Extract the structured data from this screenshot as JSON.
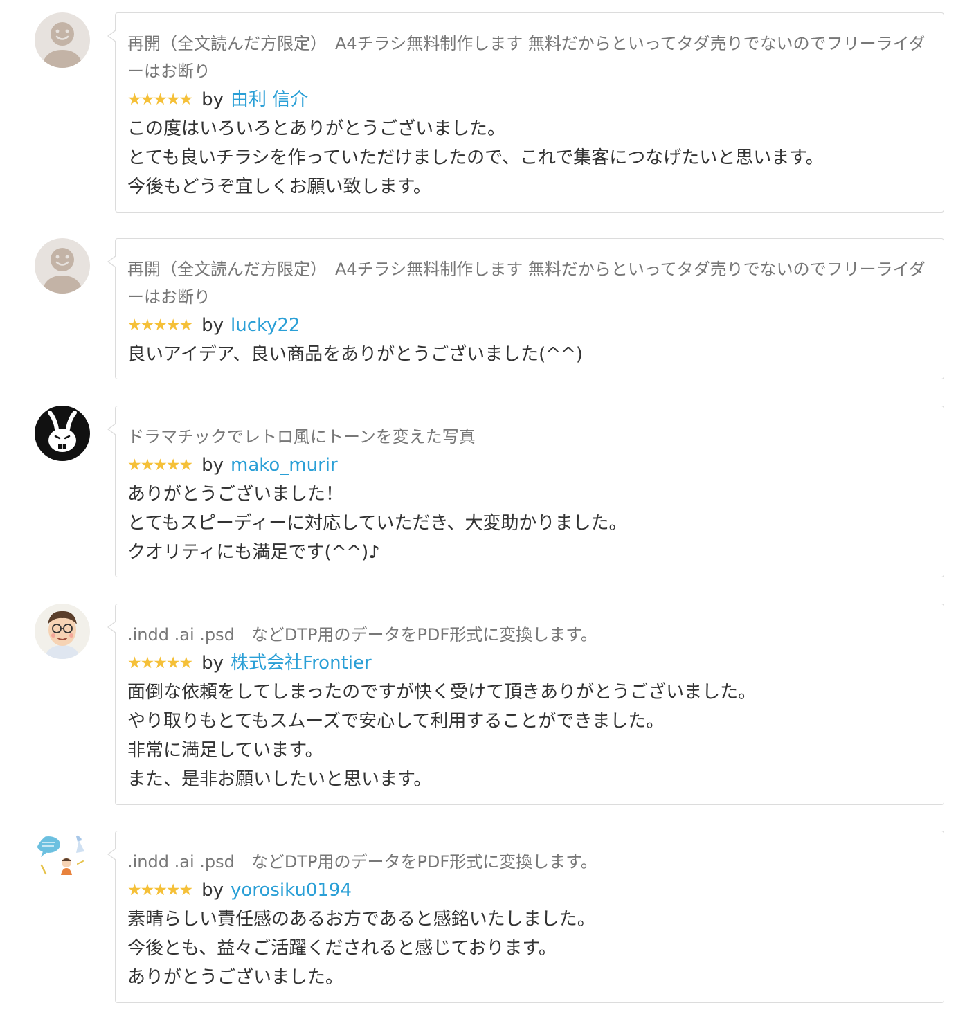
{
  "reviews": [
    {
      "avatar_icon": "default-user-icon",
      "service_title": "再開（全文読んだ方限定）　A4チラシ無料制作します 無料だからといってタダ売りでないのでフリーライダーはお断り",
      "stars": "★★★★★",
      "rating": 5,
      "by": "by",
      "username": "由利 信介",
      "comment": [
        "この度はいろいろとありがとうございました。",
        "とても良いチラシを作っていただけましたので、これで集客につなげたいと思います。",
        "今後もどうぞ宜しくお願い致します。"
      ]
    },
    {
      "avatar_icon": "default-user-icon",
      "service_title": "再開（全文読んだ方限定）　A4チラシ無料制作します 無料だからといってタダ売りでないのでフリーライダーはお断り",
      "stars": "★★★★★",
      "rating": 5,
      "by": "by",
      "username": "lucky22",
      "comment": [
        "良いアイデア、良い商品をありがとうございました(^^)"
      ]
    },
    {
      "avatar_icon": "rabbit-avatar-icon",
      "service_title": "ドラマチックでレトロ風にトーンを変えた写真",
      "stars": "★★★★★",
      "rating": 5,
      "by": "by",
      "username": "mako_murir",
      "comment": [
        "ありがとうございました！",
        "とてもスピーディーに対応していただき、大変助かりました。",
        "クオリティにも満足です(^^)♪"
      ]
    },
    {
      "avatar_icon": "man-glasses-avatar-icon",
      "service_title": ".indd .ai .psd　などDTP用のデータをPDF形式に変換します。",
      "stars": "★★★★★",
      "rating": 5,
      "by": "by",
      "username": "株式会社Frontier",
      "comment": [
        "面倒な依頼をしてしまったのですが快く受けて頂きありがとうございました。",
        "やり取りもとてもスムーズで安心して利用することができました。",
        "非常に満足しています。",
        "また、是非お願いしたいと思います。"
      ]
    },
    {
      "avatar_icon": "illustration-avatar-icon",
      "service_title": ".indd .ai .psd　などDTP用のデータをPDF形式に変換します。",
      "stars": "★★★★★",
      "rating": 5,
      "by": "by",
      "username": "yorosiku0194",
      "comment": [
        "素晴らしい責任感のあるお方であると感銘いたしました。",
        "今後とも、益々ご活躍くだされると感じております。",
        "ありがとうございました。"
      ]
    }
  ],
  "colors": {
    "star": "#f5c038",
    "username": "#2a9fd6",
    "title": "#777777",
    "border": "#dcdcdc"
  }
}
